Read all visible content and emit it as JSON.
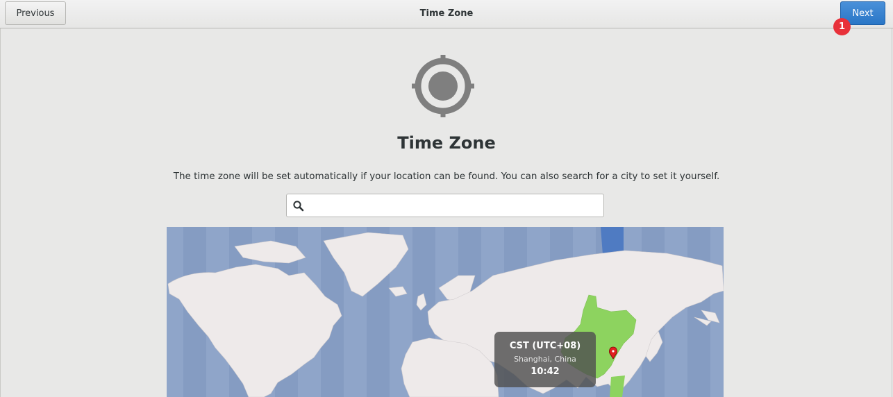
{
  "header": {
    "previous_label": "Previous",
    "title": "Time Zone",
    "next_label": "Next",
    "badge_count": "1"
  },
  "main": {
    "icon": "location-target-icon",
    "title": "Time Zone",
    "description": "The time zone will be set automatically if your location can be found. You can also search for a city to set it yourself.",
    "search": {
      "value": "",
      "placeholder": "",
      "icon": "search-icon"
    }
  },
  "map": {
    "selected_zone_name": "CST (UTC+08)",
    "selected_city": "Shanghai, China",
    "selected_time": "10:42",
    "colors": {
      "ocean": "#8fa5c9",
      "land": "#eeeaea",
      "highlight": "#8dd35f",
      "pin": "#e02020",
      "accent": "#3f7fcf"
    }
  }
}
